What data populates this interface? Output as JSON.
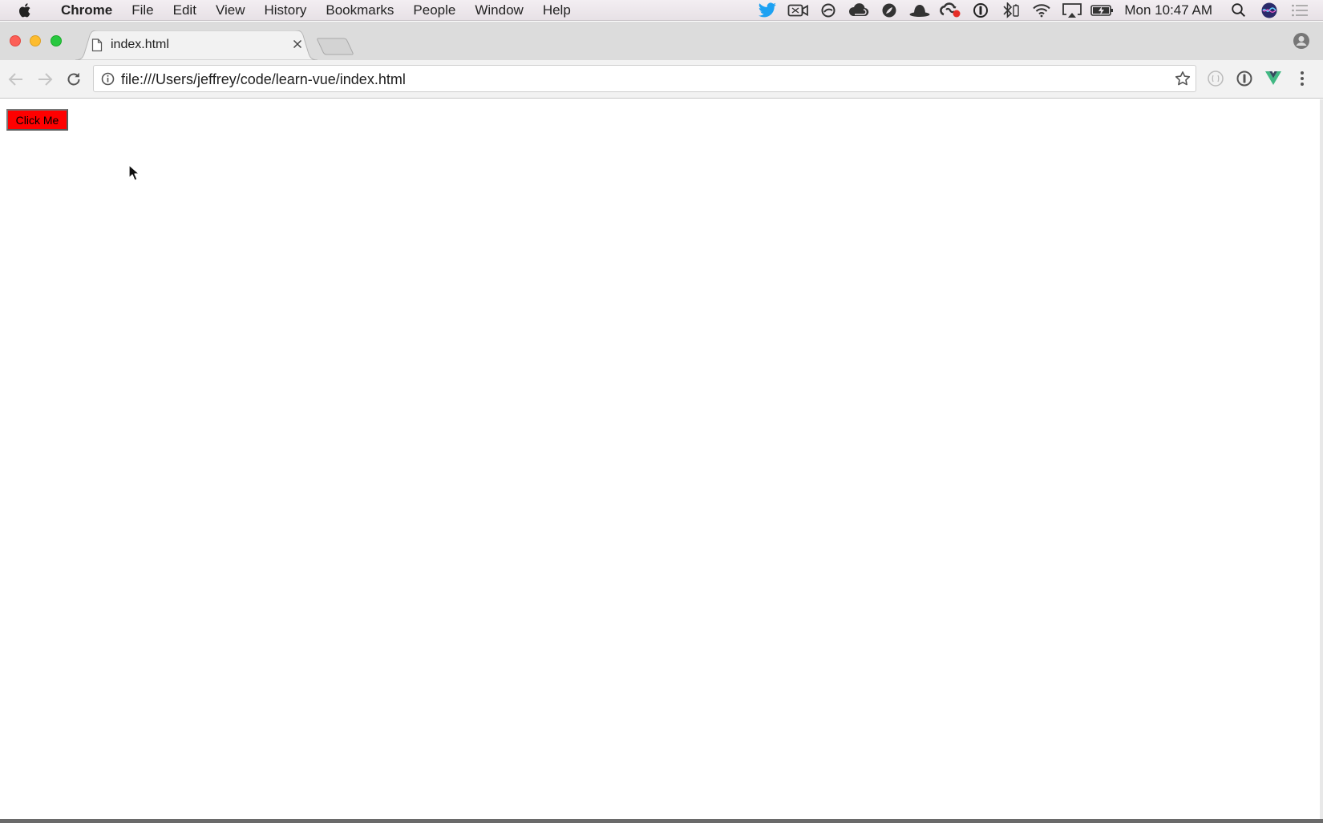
{
  "menubar": {
    "app_name": "Chrome",
    "items": [
      "File",
      "Edit",
      "View",
      "History",
      "Bookmarks",
      "People",
      "Window",
      "Help"
    ],
    "status_icons": [
      "twitter-icon",
      "camera-icon",
      "circle-slash-icon",
      "cloud-icon",
      "leaf-icon",
      "alfred-hat-icon",
      "creative-cloud-icon",
      "1password-icon",
      "bluetooth-icon",
      "wifi-icon",
      "airplay-icon",
      "battery-icon"
    ],
    "clock": "Mon 10:47 AM",
    "accent_colors": {
      "twitter": "#1da1f2",
      "close": "#fc5f57",
      "minimize": "#fdbc2e",
      "maximize": "#28c840"
    }
  },
  "browser": {
    "tab": {
      "title": "index.html",
      "favicon": "document-icon"
    },
    "address": {
      "url": "file:///Users/jeffrey/code/learn-vue/index.html"
    },
    "extensions": [
      "ghost-extension-icon",
      "1password-extension-icon",
      "vue-devtools-icon",
      "more-menu-icon"
    ]
  },
  "page": {
    "button_label": "Click Me",
    "button_color": "#ff0000"
  }
}
